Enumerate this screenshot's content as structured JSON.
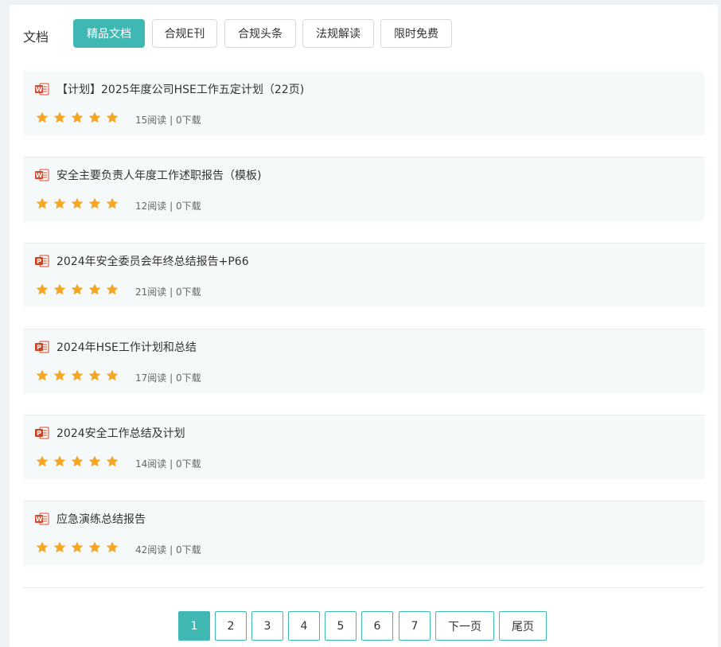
{
  "header": {
    "title": "文档",
    "tabs": [
      {
        "label": "精品文档",
        "active": true
      },
      {
        "label": "合规E刊",
        "active": false
      },
      {
        "label": "合规头条",
        "active": false
      },
      {
        "label": "法规解读",
        "active": false
      },
      {
        "label": "限时免费",
        "active": false
      }
    ]
  },
  "documents": [
    {
      "type": "word-icon",
      "title": "【计划】2025年度公司HSE工作五定计划（22页)",
      "rating": 5,
      "meta": "15阅读 | 0下载"
    },
    {
      "type": "word-icon",
      "title": "安全主要负责人年度工作述职报告（模板)",
      "rating": 5,
      "meta": "12阅读 | 0下载"
    },
    {
      "type": "ppt-icon",
      "title": "2024年安全委员会年终总结报告+P66",
      "rating": 5,
      "meta": "21阅读 | 0下载"
    },
    {
      "type": "ppt-icon",
      "title": "2024年HSE工作计划和总结",
      "rating": 5,
      "meta": "17阅读 | 0下载"
    },
    {
      "type": "ppt-icon",
      "title": "2024安全工作总结及计划",
      "rating": 5,
      "meta": "14阅读 | 0下载"
    },
    {
      "type": "word-icon",
      "title": "应急演练总结报告",
      "rating": 5,
      "meta": "42阅读 | 0下载"
    }
  ],
  "pagination": {
    "pages": [
      "1",
      "2",
      "3",
      "4",
      "5",
      "6",
      "7"
    ],
    "current": "1",
    "next_label": "下一页",
    "last_label": "尾页"
  },
  "colors": {
    "accent": "#3fb8b3",
    "star": "#f5a623",
    "word_icon": "#d9472b",
    "ppt_icon": "#d04423"
  }
}
